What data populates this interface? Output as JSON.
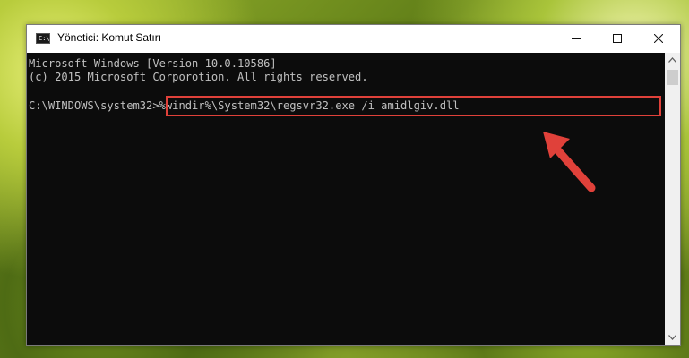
{
  "window": {
    "title": "Yönetici: Komut Satırı",
    "icon": "cmd-icon",
    "icon_text": "C:\\"
  },
  "controls": {
    "minimize_icon": "minimize-icon",
    "maximize_icon": "maximize-icon",
    "close_icon": "close-icon"
  },
  "console": {
    "line1": "Microsoft Windows [Version 10.0.10586]",
    "line2": "(c) 2015 Microsoft Corporotion. All rights reserved.",
    "prompt": "C:\\WINDOWS\\system32>",
    "command": "%windir%\\System32\\regsvr32.exe /i amidlgiv.dll"
  },
  "scrollbar": {
    "up_icon": "chevron-up-icon",
    "down_icon": "chevron-down-icon"
  },
  "colors": {
    "highlight": "#e0413a",
    "arrow": "#e0413a",
    "console_bg": "#0c0c0c",
    "console_text": "#c0c0c0"
  }
}
